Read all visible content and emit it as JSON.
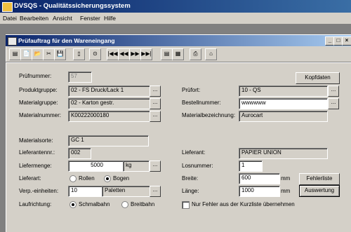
{
  "app_title": "DVSQS - Qualitätssicherungssystem",
  "menu": [
    "Datei",
    "Bearbeiten",
    "Ansicht",
    "Fenster",
    "Hilfe"
  ],
  "window": {
    "title": "Prüfauftrag für den Wareneingang",
    "buttons": {
      "minimize": "_",
      "restore": "□",
      "close": "×"
    }
  },
  "toolbar_icons": [
    "new-doc-icon",
    "open-icon",
    "folder-icon",
    "tools-icon",
    "save-icon",
    "delete-icon",
    "print-preview-icon",
    "first-record-icon",
    "prev-record-icon",
    "next-record-icon",
    "last-record-icon",
    "list-view-icon",
    "grid-view-icon",
    "print-icon",
    "exit-icon"
  ],
  "toolbar_glyphs": [
    "▤",
    "📄",
    "📂",
    "✂",
    "💾",
    "▯",
    "⊙",
    "|◀◀",
    "◀◀",
    "▶▶",
    "▶▶|",
    "▤",
    "▦",
    "⎙",
    "⌂"
  ],
  "form": {
    "pruefnummer": {
      "label": "Prüfnummer:",
      "value": "57"
    },
    "kopfdaten_button": "Kopfdaten",
    "produktgruppe": {
      "label": "Produktgruppe:",
      "value": "02 - FS Druck/Lack 1"
    },
    "materialgruppe": {
      "label": "Materialgruppe:",
      "value": "02 - Karton gestr."
    },
    "materialnummer": {
      "label": "Materialnummer:",
      "value": "K00222000180"
    },
    "pruefort": {
      "label": "Prüfort:",
      "value": "10 - QS"
    },
    "bestellnummer": {
      "label": "Bestellnummer:",
      "value": "wwwwww"
    },
    "materialbezeichnung": {
      "label": "Materialbezeichnung:",
      "value": "Aurocart"
    },
    "materialsorte": {
      "label": "Materialsorte:",
      "value": "GC 1"
    },
    "lieferantennr": {
      "label": "Lieferantennr.:",
      "value": "002"
    },
    "liefermenge": {
      "label": "Liefermenge:",
      "value": "5000",
      "unit": "kg"
    },
    "lieferart": {
      "label": "Lieferart:",
      "option1": "Rollen",
      "option2": "Bogen",
      "selected": "Bogen"
    },
    "verpackungseinheiten": {
      "label": "Verp.-einheiten:",
      "value": "10",
      "unit": "Paletten"
    },
    "laufrichtung": {
      "label": "Laufrichtung:",
      "option1": "Schmalbahn",
      "option2": "Breitbahn",
      "selected": "Schmalbahn"
    },
    "lieferant": {
      "label": "Lieferant:",
      "value": "PAPIER UNION"
    },
    "losnummer": {
      "label": "Losnummer:",
      "value": "1"
    },
    "breite": {
      "label": "Breite:",
      "value": "600",
      "unit": "mm"
    },
    "laenge": {
      "label": "Länge:",
      "value": "1000",
      "unit": "mm"
    },
    "fehlerliste_button": "Fehlerliste",
    "auswertung_button": "Auswertung",
    "kurzliste_checkbox": {
      "label": "Nur Fehler aus der Kurzliste übernehmen",
      "checked": false
    }
  }
}
